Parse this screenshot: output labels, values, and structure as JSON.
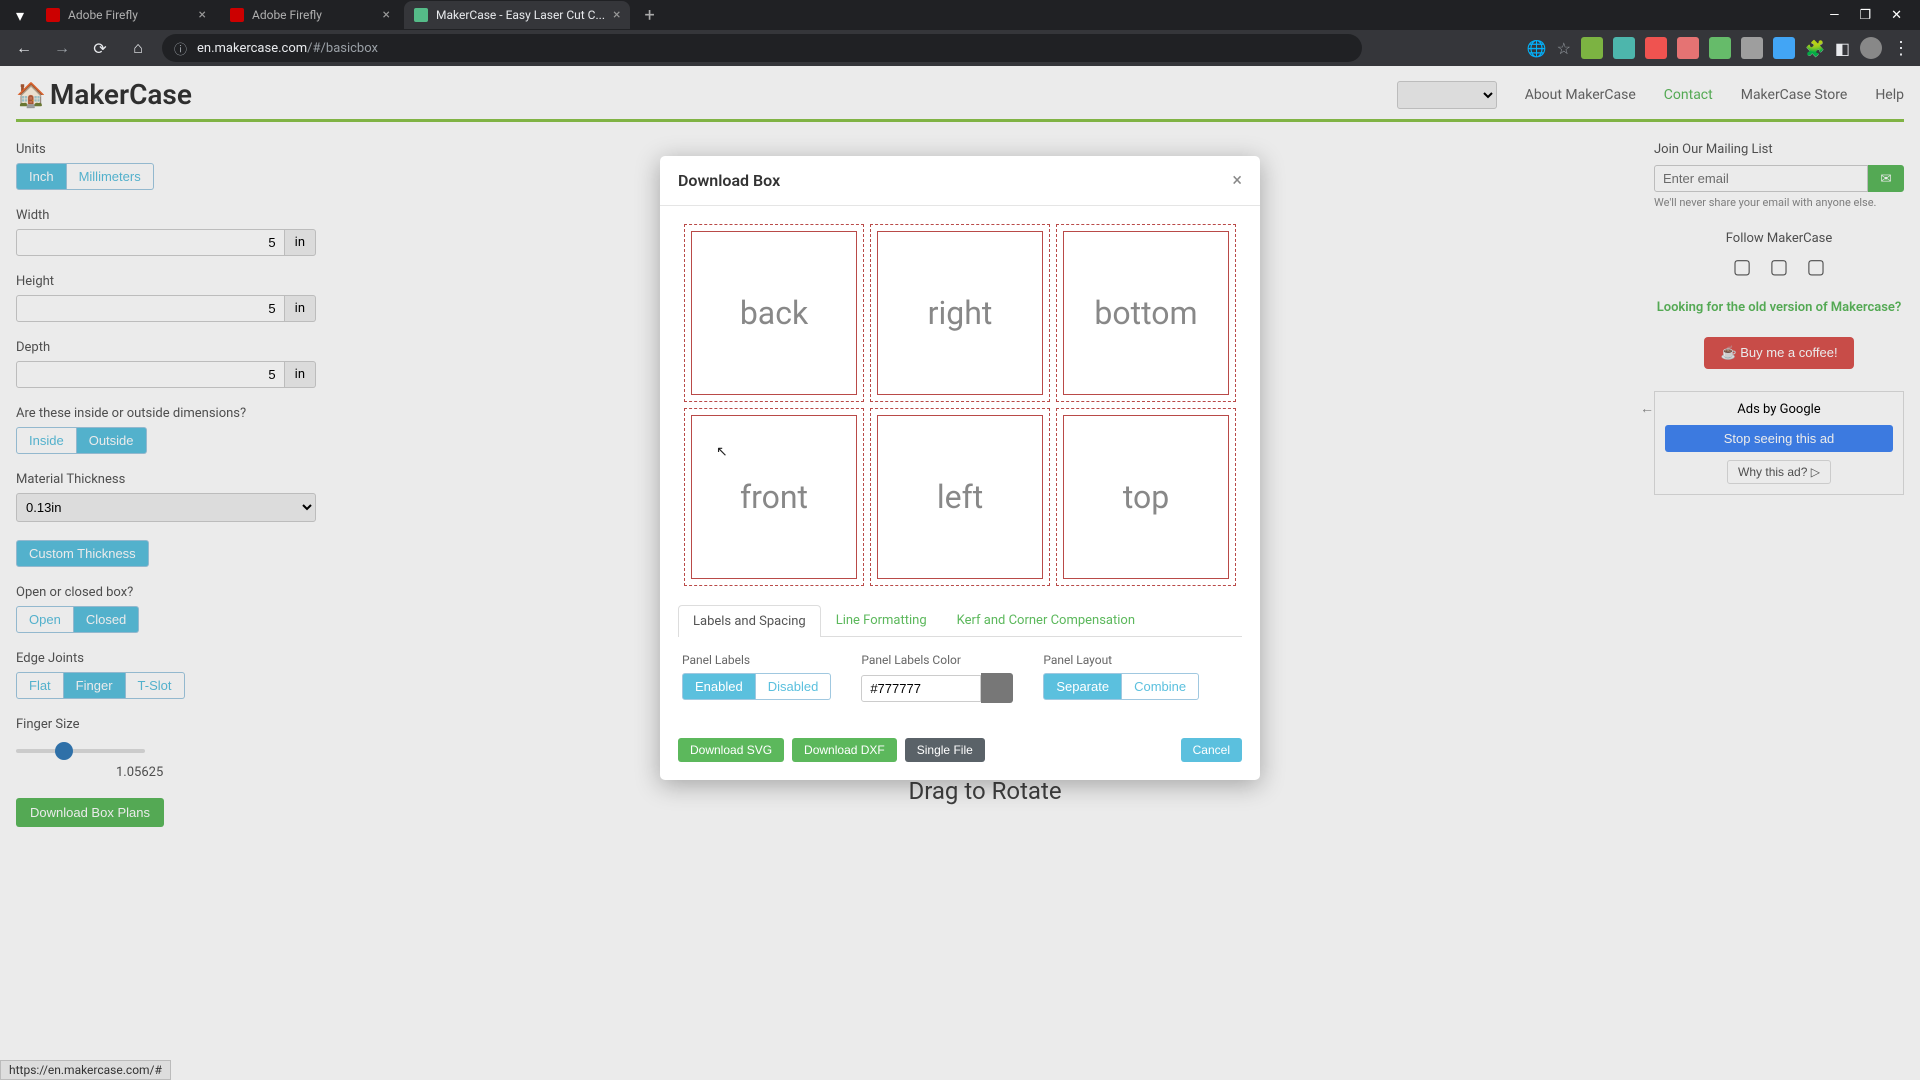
{
  "browser": {
    "tabs": [
      {
        "title": "Adobe Firefly"
      },
      {
        "title": "Adobe Firefly"
      },
      {
        "title": "MakerCase - Easy Laser Cut C..."
      }
    ],
    "url_prefix": "en.makercase.com",
    "url_path": "/#/basicbox",
    "window": {
      "minimize": "—",
      "maximize": "❐",
      "close": "✕"
    }
  },
  "header": {
    "logo": "MakerCase",
    "nav": {
      "about": "About MakerCase",
      "contact": "Contact",
      "store": "MakerCase Store",
      "help": "Help"
    }
  },
  "sidebar": {
    "units": {
      "label": "Units",
      "inch": "Inch",
      "mm": "Millimeters"
    },
    "width": {
      "label": "Width",
      "value": "5",
      "unit": "in"
    },
    "height": {
      "label": "Height",
      "value": "5",
      "unit": "in"
    },
    "depth": {
      "label": "Depth",
      "value": "5",
      "unit": "in"
    },
    "dims": {
      "label": "Are these inside or outside dimensions?",
      "inside": "Inside",
      "outside": "Outside"
    },
    "thickness": {
      "label": "Material Thickness",
      "value": "0.13in"
    },
    "custom": "Custom Thickness",
    "openclosed": {
      "label": "Open or closed box?",
      "open": "Open",
      "closed": "Closed"
    },
    "edge": {
      "label": "Edge Joints",
      "flat": "Flat",
      "finger": "Finger",
      "tslot": "T-Slot"
    },
    "finger": {
      "label": "Finger Size",
      "value": "1.05625"
    },
    "download": "Download Box Plans"
  },
  "canvas": {
    "drag": "Drag to Rotate"
  },
  "right": {
    "mailing": {
      "title": "Join Our Mailing List",
      "placeholder": "Enter email",
      "note": "We'll never share your email with anyone else."
    },
    "follow": "Follow MakerCase",
    "oldlink": "Looking for the old version of Makercase?",
    "coffee": "☕ Buy me a coffee!",
    "ads": {
      "label": "Ads by Google",
      "stop": "Stop seeing this ad",
      "why": "Why this ad? ▷"
    }
  },
  "modal": {
    "title": "Download Box",
    "panels": [
      "back",
      "right",
      "bottom",
      "front",
      "left",
      "top"
    ],
    "tabs": {
      "labels": "Labels and Spacing",
      "line": "Line Formatting",
      "kerf": "Kerf and Corner Compensation"
    },
    "controls": {
      "panel_labels": {
        "label": "Panel Labels",
        "enabled": "Enabled",
        "disabled": "Disabled"
      },
      "labels_color": {
        "label": "Panel Labels Color",
        "value": "#777777"
      },
      "layout": {
        "label": "Panel Layout",
        "separate": "Separate",
        "combine": "Combine"
      }
    },
    "footer": {
      "svg": "Download SVG",
      "dxf": "Download DXF",
      "single": "Single File",
      "cancel": "Cancel"
    }
  },
  "status": "https://en.makercase.com/#"
}
